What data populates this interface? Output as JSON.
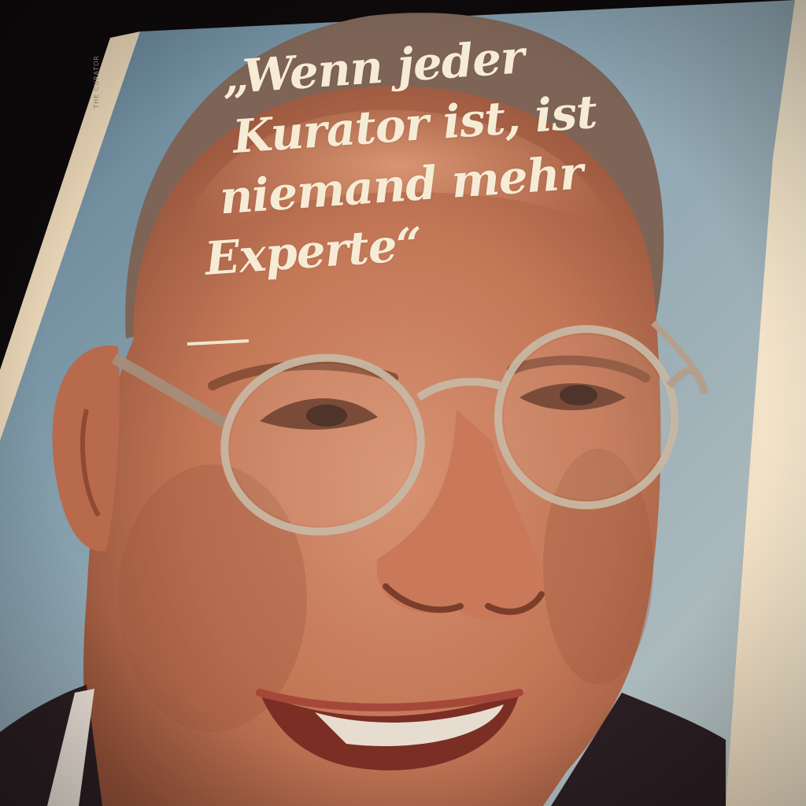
{
  "magazine": {
    "spine_label": "THE CURATOR",
    "quote": {
      "lines": [
        "„Wenn jeder",
        "Kurator ist, ist",
        "niemand mehr",
        "Experte“"
      ]
    }
  },
  "colors": {
    "background": "#0e0a0c",
    "backdrop_blue": "#8fa7b3",
    "skin": "#c47a5c",
    "quote_text": "#f6ecd6"
  }
}
